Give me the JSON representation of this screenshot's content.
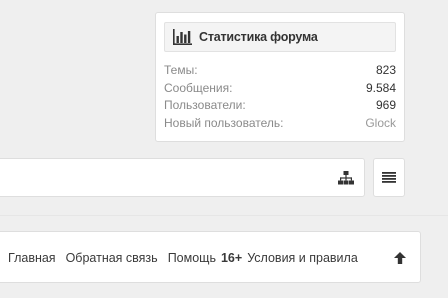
{
  "stats": {
    "title": "Статистика форума",
    "icon": "bar-chart-icon",
    "rows": [
      {
        "label": "Темы:",
        "value": "823"
      },
      {
        "label": "Сообщения:",
        "value": "9.584"
      },
      {
        "label": "Пользователи:",
        "value": "969"
      },
      {
        "label": "Новый пользователь:",
        "value": "Glock"
      }
    ]
  },
  "toolbar": {
    "sitemap_icon": "sitemap-icon",
    "menu_icon": "menu-icon"
  },
  "footer": {
    "links": {
      "home": "Главная",
      "feedback": "Обратная связь",
      "help": "Помощь",
      "age_badge": "16+",
      "terms": "Условия и правила"
    },
    "to_top_icon": "arrow-up-icon"
  }
}
